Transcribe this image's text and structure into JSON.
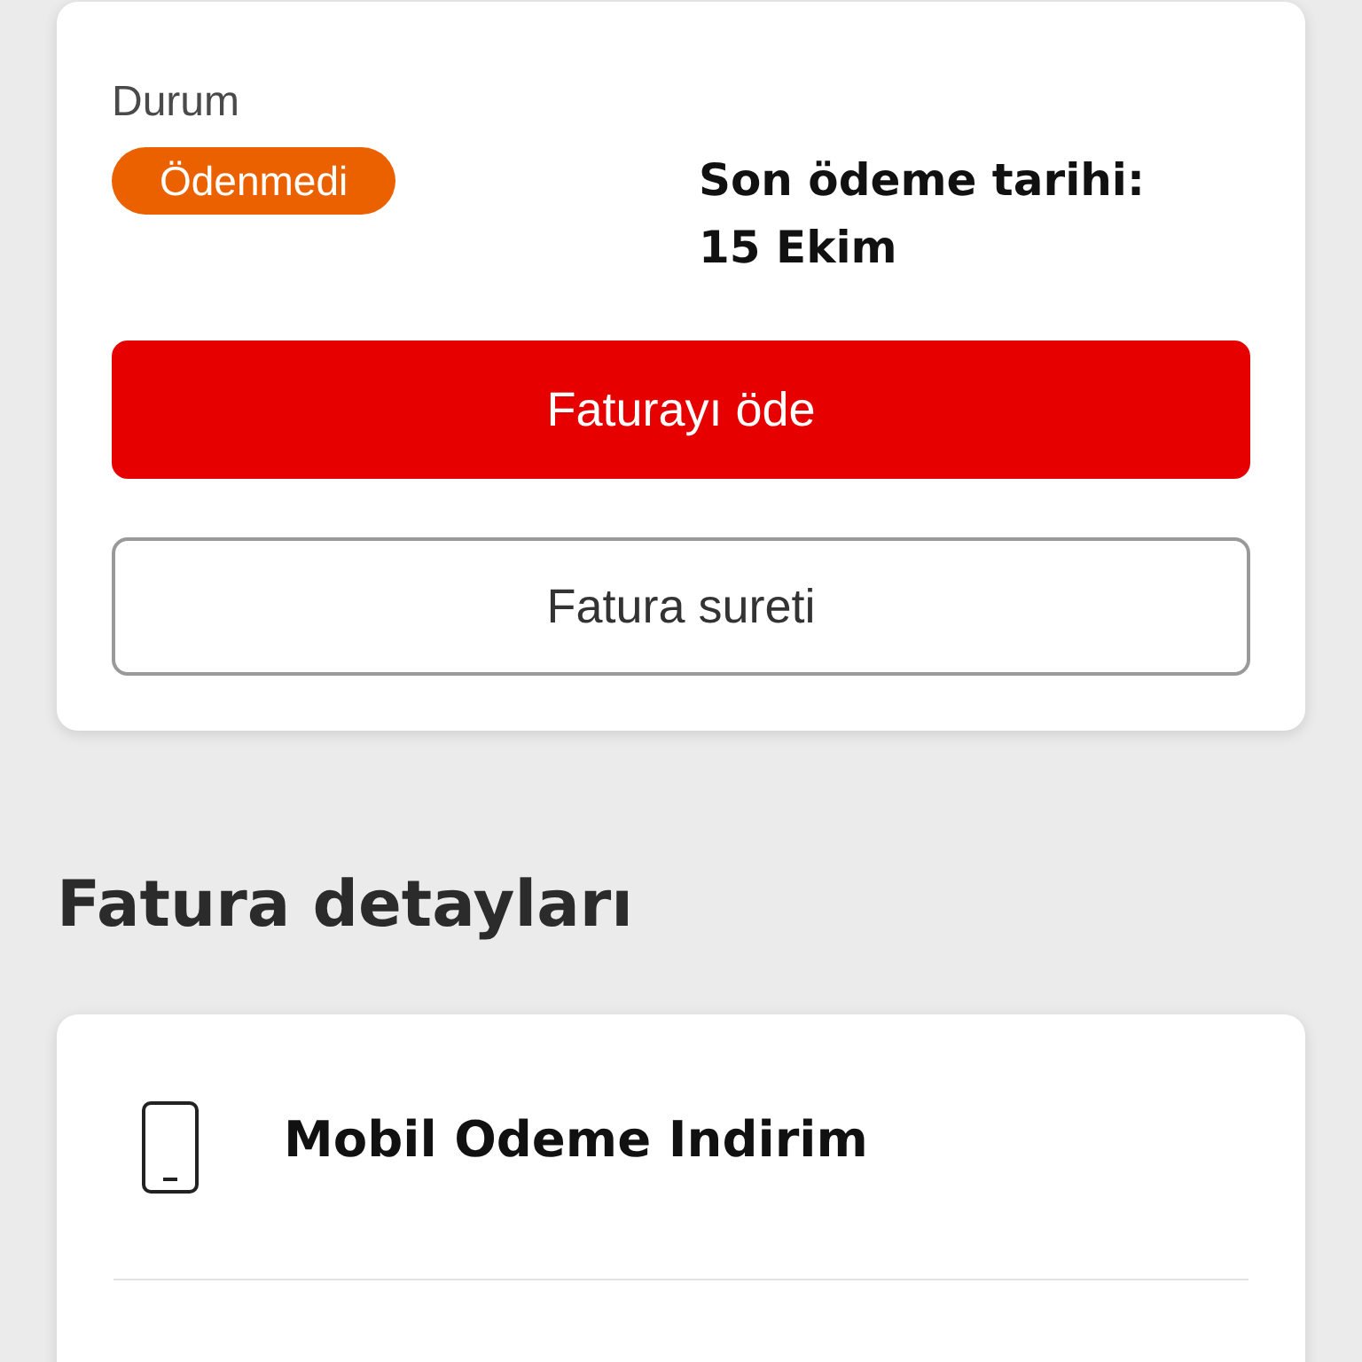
{
  "bill_status_card": {
    "status_label": "Durum",
    "status_badge": "Ödenmedi",
    "due_date_label": "Son ödeme tarihi:",
    "due_date": "15 Ekim",
    "buttons": [
      {
        "label": "Faturayı öde",
        "kind": "primary"
      },
      {
        "label": "Fatura sureti",
        "kind": "secondary"
      }
    ]
  },
  "bill_details": {
    "title": "Fatura detayları",
    "items": [
      {
        "label": "Mobil Odeme Indirim"
      }
    ]
  }
}
